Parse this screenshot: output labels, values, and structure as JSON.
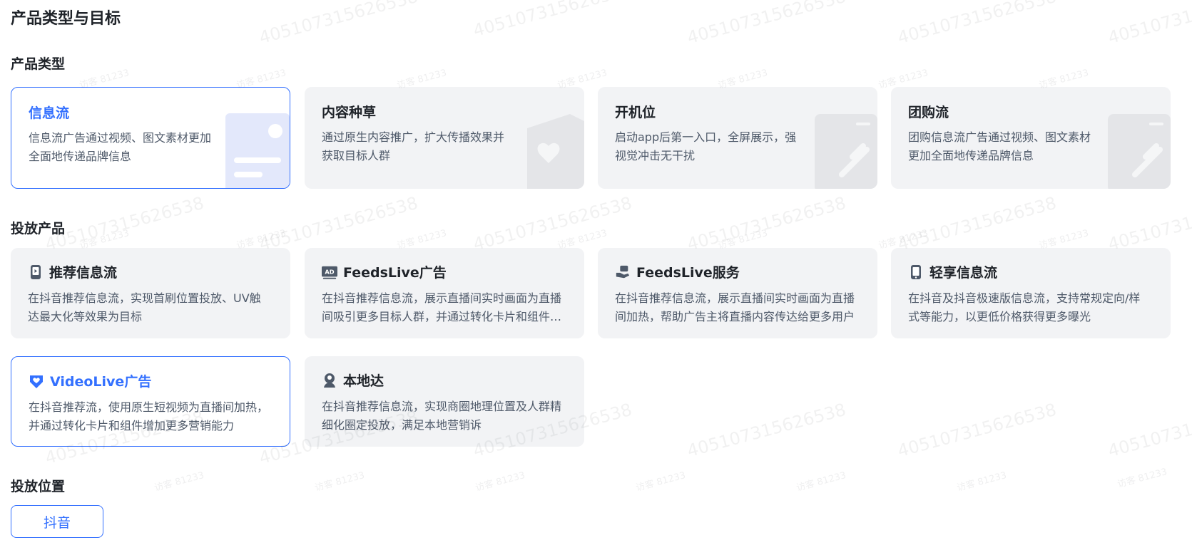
{
  "main_title": "产品类型与目标",
  "sections": {
    "product_type": "产品类型",
    "delivery_product": "投放产品",
    "delivery_position": "投放位置"
  },
  "product_types": [
    {
      "title": "信息流",
      "desc": "信息流广告通过视频、图文素材更加全面地传递品牌信息",
      "selected": true
    },
    {
      "title": "内容种草",
      "desc": "通过原生内容推广，扩大传播效果并获取目标人群",
      "selected": false
    },
    {
      "title": "开机位",
      "desc": "启动app后第一入口，全屏展示，强视觉冲击无干扰",
      "selected": false
    },
    {
      "title": "团购流",
      "desc": "团购信息流广告通过视频、图文素材更加全面地传递品牌信息",
      "selected": false
    }
  ],
  "delivery_products": [
    {
      "title": "推荐信息流",
      "icon": "phone-play-icon",
      "desc": "在抖音推荐信息流，实现首刷位置投放、UV触达最大化等效果为目标",
      "selected": false
    },
    {
      "title": "FeedsLive广告",
      "icon": "ad-badge-icon",
      "desc": "在抖音推荐信息流，展示直播间实时画面为直播间吸引更多目标人群，并通过转化卡片和组件增加更多营销",
      "selected": false
    },
    {
      "title": "FeedsLive服务",
      "icon": "hand-service-icon",
      "desc": "在抖音推荐信息流，展示直播间实时画面为直播间加热，帮助广告主将直播内容传达给更多用户",
      "selected": false
    },
    {
      "title": "轻享信息流",
      "icon": "phone-icon",
      "desc": "在抖音及抖音极速版信息流，支持常规定向/样式等能力，以更低价格获得更多曝光",
      "selected": false
    },
    {
      "title": "VideoLive广告",
      "icon": "heart-shield-icon",
      "desc": "在抖音推荐流，使用原生短视频为直播间加热，并通过转化卡片和组件增加更多营销能力",
      "selected": true
    },
    {
      "title": "本地达",
      "icon": "location-person-icon",
      "desc": "在抖音推荐信息流，实现商圈地理位置及人群精细化圈定投放，满足本地营销诉",
      "selected": false
    }
  ],
  "delivery_position": {
    "label": "抖音"
  },
  "watermark": {
    "id": "405107315626538",
    "visitor": "访客 81233"
  },
  "colors": {
    "accent": "#3370ff",
    "card_bg": "#f2f3f5",
    "text": "#1f2329",
    "desc": "#4e5969"
  }
}
